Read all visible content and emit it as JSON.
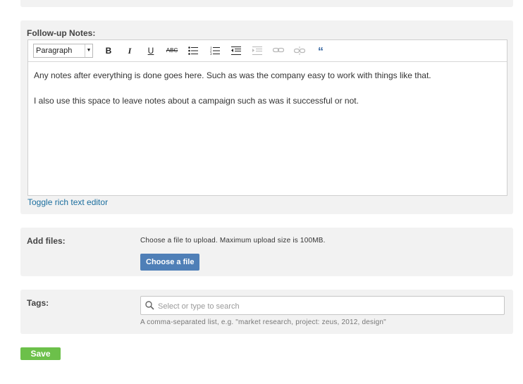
{
  "notes": {
    "label": "Follow-up Notes:",
    "format_selected": "Paragraph",
    "toolbar": {
      "bold": "B",
      "italic": "I",
      "underline": "U",
      "strikethrough": "ABC",
      "blockquote": "“"
    },
    "paragraphs": [
      "Any notes after everything is done goes here. Such as was the company easy to work with things like that.",
      "I also use this space to leave notes about a campaign such as was it successful or not."
    ],
    "toggle_link": "Toggle rich text editor"
  },
  "files": {
    "label": "Add files:",
    "help": "Choose a file to upload. Maximum upload size is 100MB.",
    "button": "Choose a file"
  },
  "tags": {
    "label": "Tags:",
    "placeholder": "Select or type to search",
    "value": "",
    "help": "A comma-separated list, e.g. \"market research, project: zeus, 2012, design\""
  },
  "save_button": "Save",
  "colors": {
    "panel_bg": "#f2f2f2",
    "link": "#1b6e9e",
    "choose_button": "#4f7fb7",
    "save_button": "#6cc04a"
  }
}
